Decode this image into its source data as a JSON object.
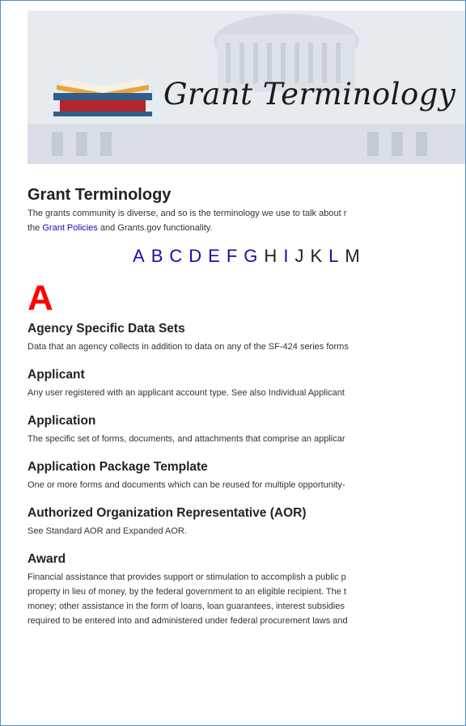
{
  "banner": {
    "title": "Grant Terminology"
  },
  "page": {
    "title": "Grant Terminology",
    "intro_line1": "The grants community is diverse, and so is the terminology we use to talk about r",
    "intro_prefix": "the ",
    "intro_link": "Grant Policies",
    "intro_suffix": " and Grants.gov functionality."
  },
  "alphabet": {
    "letters": [
      "A",
      "B",
      "C",
      "D",
      "E",
      "F",
      "G",
      "H",
      "I",
      "J",
      "K",
      "L",
      "M"
    ],
    "linked": [
      true,
      true,
      true,
      true,
      true,
      true,
      true,
      false,
      true,
      false,
      false,
      true,
      false
    ]
  },
  "section": {
    "letter": "A"
  },
  "terms": [
    {
      "title": "Agency Specific Data Sets",
      "definition": "Data that an agency collects in addition to data on any of the SF-424 series forms"
    },
    {
      "title": "Applicant",
      "definition": "Any user registered with an applicant account type. See also Individual Applicant"
    },
    {
      "title": "Application",
      "definition": "The specific set of forms, documents, and attachments that comprise an applicar"
    },
    {
      "title": "Application Package Template",
      "definition": "One or more forms and documents which can be reused for multiple opportunity-"
    },
    {
      "title": "Authorized Organization Representative (AOR)",
      "definition": "See Standard AOR and Expanded AOR."
    },
    {
      "title": "Award",
      "definition_lines": [
        "Financial assistance that provides support or stimulation to accomplish a public p",
        "property in lieu of money, by the federal government to an eligible recipient. The t",
        "money; other assistance in the form of loans, loan guarantees, interest subsidies",
        "required to be entered into and administered under federal procurement laws and"
      ]
    }
  ],
  "colors": {
    "link": "#1a0dab",
    "section_letter": "#ff0000",
    "frame": "#4a90d9"
  }
}
